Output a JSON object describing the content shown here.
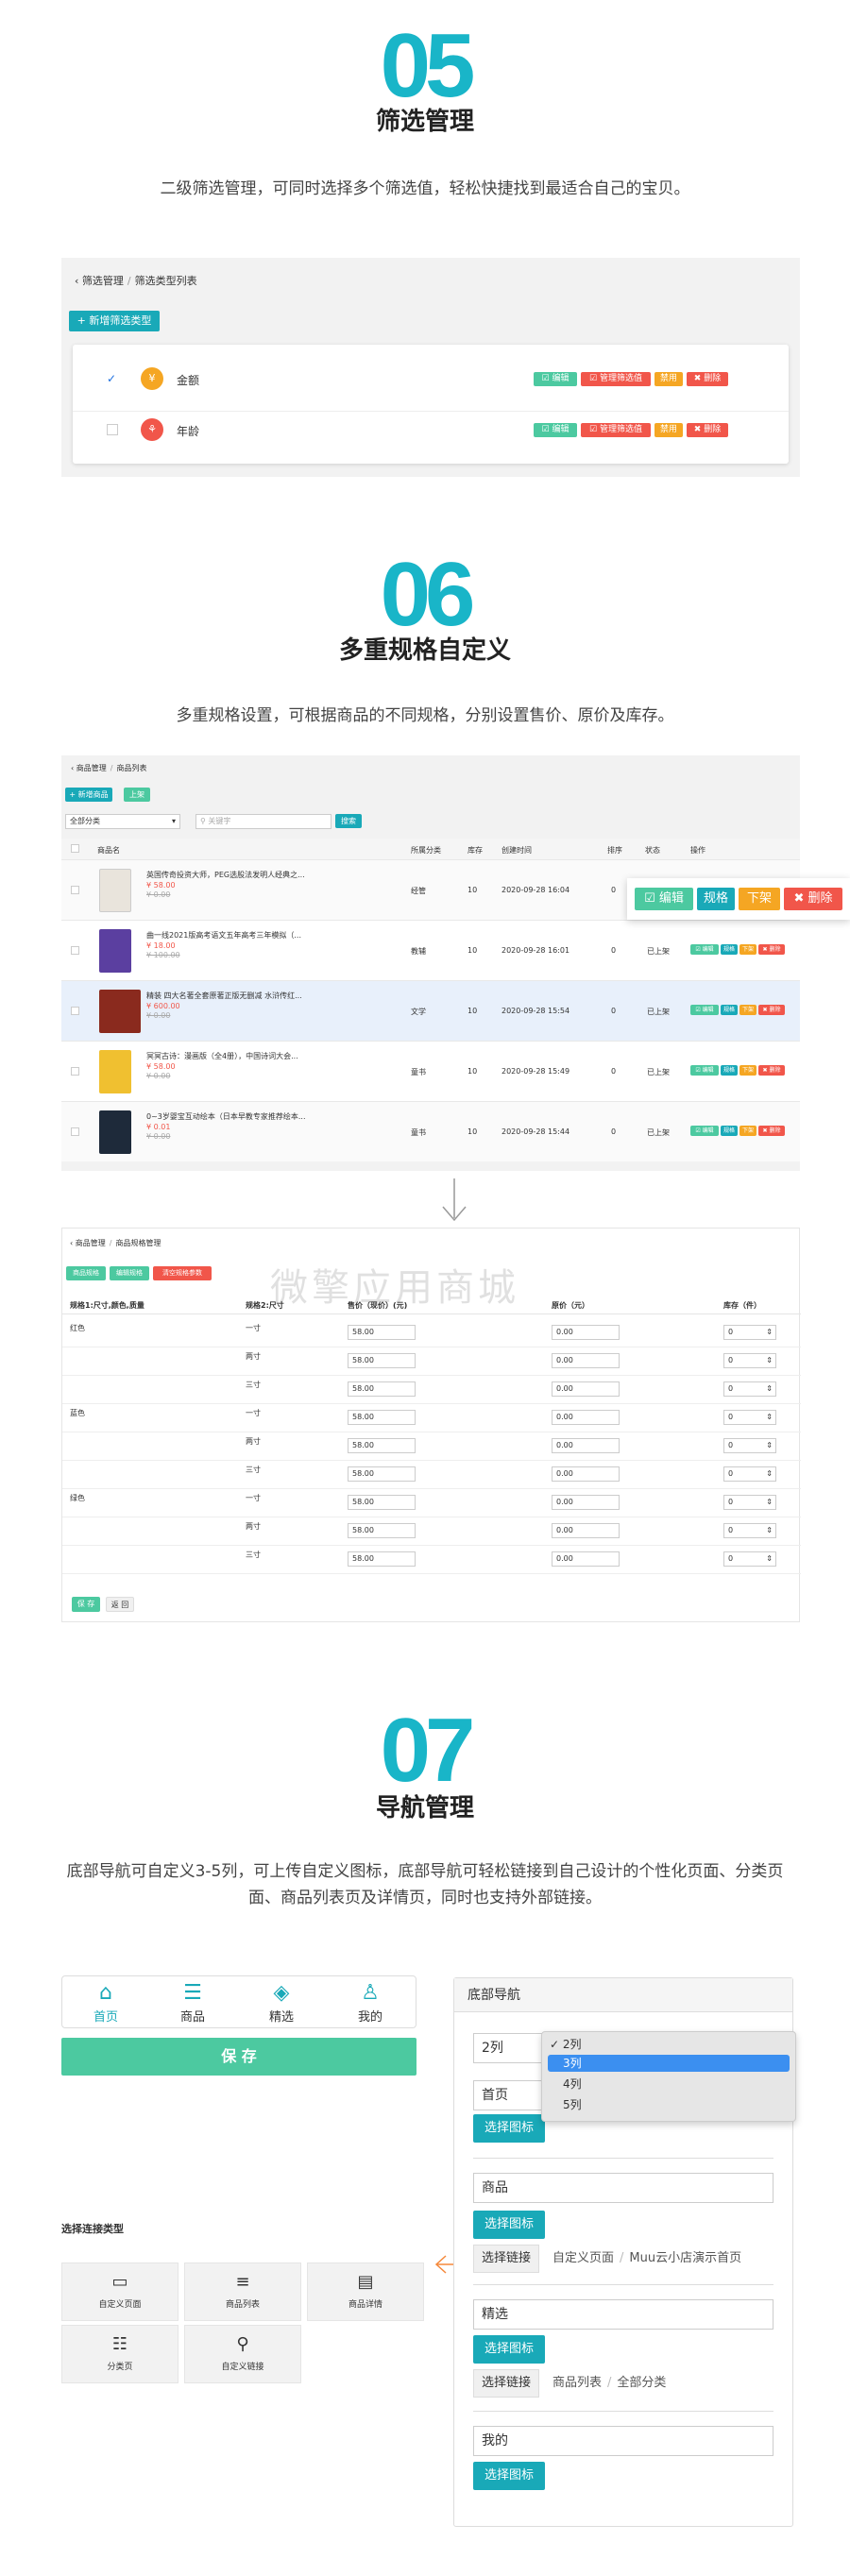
{
  "s05": {
    "num": "05",
    "title": "筛选管理",
    "desc": "二级筛选管理，可同时选择多个筛选值，轻松快捷找到最适合自己的宝贝。",
    "crumb": [
      "筛选管理",
      "筛选类型列表"
    ],
    "add": "+ 新增筛选类型",
    "items": [
      {
        "name": "金额",
        "checked": "✓"
      },
      {
        "name": "年龄",
        "checked": ""
      }
    ],
    "btns": {
      "edit": "☑ 编辑",
      "manage": "☑ 管理筛选值",
      "disable": "禁用",
      "del": "✖ 删除"
    }
  },
  "s06": {
    "num": "06",
    "title": "多重规格自定义",
    "desc": "多重规格设置，可根据商品的不同规格，分别设置售价、原价及库存。",
    "crumb": [
      "商品管理",
      "商品列表"
    ],
    "add": "+ 新增商品",
    "up": "上架",
    "category": "全部分类",
    "search_ph": "关键字",
    "search": "搜索",
    "cols": [
      "商品名",
      "所属分类",
      "库存",
      "创建时间",
      "排序",
      "状态",
      "操作"
    ],
    "rows": [
      {
        "name": "英国传奇投资大师，PEG选股法发明人经典之...",
        "price": "¥ 58.00",
        "orig": "¥ 0.00",
        "cat": "经管",
        "stock": "10",
        "time": "2020-09-28 16:04",
        "sort": "0",
        "status": ""
      },
      {
        "name": "曲一线2021版高考语文五年高考三年模拟（...",
        "price": "¥ 18.00",
        "orig": "¥ 100.00",
        "cat": "教辅",
        "stock": "10",
        "time": "2020-09-28 16:01",
        "sort": "0",
        "status": "已上架"
      },
      {
        "name": "精装 四大名著全套原著正版无删减 水浒传红...",
        "price": "¥ 600.00",
        "orig": "¥ 0.00",
        "cat": "文学",
        "stock": "10",
        "time": "2020-09-28 15:54",
        "sort": "0",
        "status": "已上架"
      },
      {
        "name": "冥冥古诗：漫画版（全4册），中国诗词大会...",
        "price": "¥ 58.00",
        "orig": "¥ 0.00",
        "cat": "童书",
        "stock": "10",
        "time": "2020-09-28 15:49",
        "sort": "0",
        "status": "已上架"
      },
      {
        "name": "0~3岁婴宝互动绘本（日本早教专家推荐绘本...",
        "price": "¥ 0.01",
        "orig": "¥ 0.00",
        "cat": "童书",
        "stock": "10",
        "time": "2020-09-28 15:44",
        "sort": "0",
        "status": "已上架"
      }
    ],
    "ops": {
      "edit": "☑ 编辑",
      "spec": "规格",
      "down": "下架",
      "del": "✖ 删除"
    },
    "spec": {
      "crumb": [
        "商品管理",
        "商品规格管理"
      ],
      "tabs": [
        "商品规格",
        "编辑规格",
        "清空规格参数"
      ],
      "cols": [
        "规格1:尺寸,颜色,质量",
        "规格2:尺寸",
        "售价（现价）(元)",
        "原价（元）",
        "库存（件）"
      ],
      "colors": [
        "红色",
        "蓝色",
        "绿色"
      ],
      "sizes": [
        "一寸",
        "两寸",
        "三寸"
      ],
      "price": "58.00",
      "orig": "0.00",
      "stock": "0",
      "save": "保 存",
      "back": "返 回"
    },
    "watermark": "微擎应用商城"
  },
  "s07": {
    "num": "07",
    "title": "导航管理",
    "desc": "底部导航可自定义3-5列，可上传自定义图标，底部导航可轻松链接到自己设计的个性化页面、分类页面、商品列表页及详情页，同时也支持外部链接。",
    "tabbar": [
      {
        "icon": "⌂",
        "label": "首页"
      },
      {
        "icon": "☰",
        "label": "商品"
      },
      {
        "icon": "◈",
        "label": "精选"
      },
      {
        "icon": "♙",
        "label": "我的"
      }
    ],
    "save": "保 存",
    "linktype_title": "选择连接类型",
    "tiles": [
      {
        "icon": "▭",
        "label": "自定义页面"
      },
      {
        "icon": "≡",
        "label": "商品列表"
      },
      {
        "icon": "▤",
        "label": "商品详情"
      },
      {
        "icon": "☷",
        "label": "分类页"
      },
      {
        "icon": "⚲",
        "label": "自定义链接"
      }
    ],
    "nav": {
      "header": "底部导航",
      "cols_value": "2列",
      "dropdown": [
        "✓ 2列",
        "3列",
        "4列",
        "5列"
      ],
      "names": [
        "首页",
        "商品",
        "精选",
        "我的"
      ],
      "choose_icon": "选择图标",
      "choose_link": "选择链接",
      "link1": [
        "自定义页面",
        "Muu云小店演示首页"
      ],
      "link2": [
        "商品列表",
        "全部分类"
      ]
    }
  },
  "colors": {
    "accent": "#19b5c8",
    "teal": "#19a9b8",
    "green": "#4cc9a0",
    "red": "#f1564a",
    "orange": "#f5a623"
  }
}
